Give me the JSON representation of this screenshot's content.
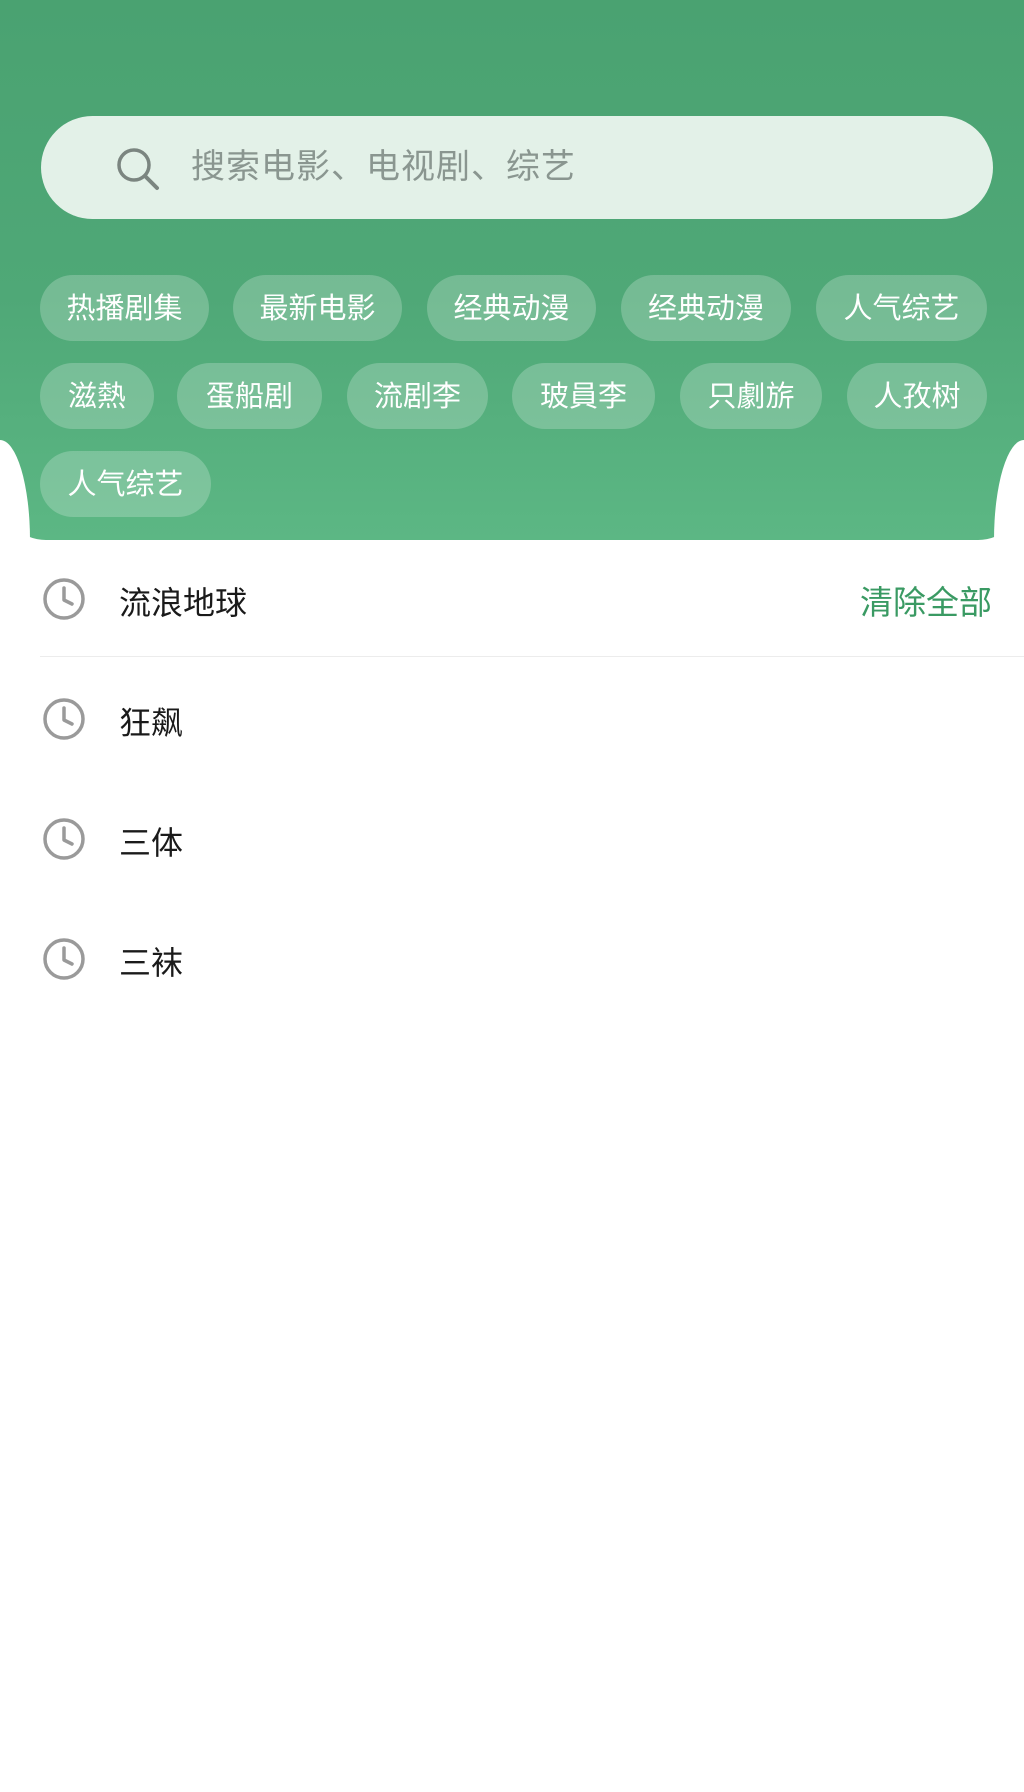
{
  "search": {
    "placeholder": "搜索电影、电视剧、综艺"
  },
  "tags": {
    "row1": [
      "热播剧集",
      "最新电影",
      "经典动漫",
      "经典动漫",
      "人气综艺"
    ],
    "row2": [
      "滋熱",
      "蛋船剧",
      "流剧李",
      "玻員李",
      "只劇旂",
      "人孜树"
    ],
    "row3": [
      "人气综艺"
    ]
  },
  "history": {
    "clear_all": "清除全部",
    "items": [
      "流浪地球",
      "狂飙",
      "三体",
      "三袜"
    ]
  },
  "colors": {
    "header_green": "#4fa877",
    "accent_green": "#3a9a63",
    "search_bg": "#e3f1e8"
  },
  "icons": {
    "search": "search-icon",
    "history": "clock-icon"
  }
}
